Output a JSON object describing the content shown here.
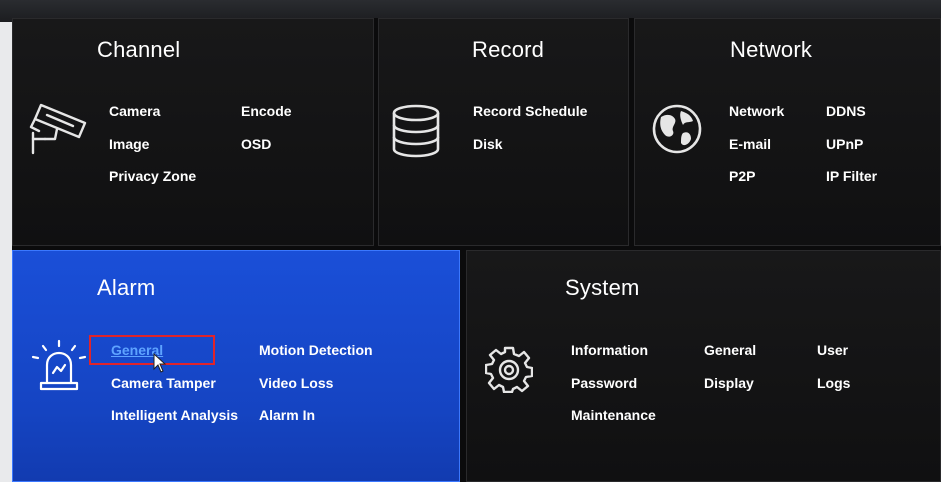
{
  "tiles": {
    "channel": {
      "title": "Channel",
      "icon": "camera-icon",
      "items": [
        "Camera",
        "Encode",
        "Image",
        "OSD",
        "Privacy Zone"
      ]
    },
    "record": {
      "title": "Record",
      "icon": "disk-stack-icon",
      "items": [
        "Record Schedule",
        "Disk"
      ]
    },
    "network": {
      "title": "Network",
      "icon": "globe-icon",
      "items": [
        "Network",
        "DDNS",
        "E-mail",
        "UPnP",
        "P2P",
        "IP Filter"
      ]
    },
    "alarm": {
      "title": "Alarm",
      "icon": "alarm-light-icon",
      "items": [
        "General",
        "Motion Detection",
        "Camera Tamper",
        "Video Loss",
        "Intelligent Analysis",
        "Alarm In"
      ],
      "active_item": "General"
    },
    "system": {
      "title": "System",
      "icon": "gear-icon",
      "items": [
        "Information",
        "General",
        "User",
        "Password",
        "Display",
        "Logs",
        "Maintenance"
      ]
    }
  },
  "colors": {
    "selected_tile": "#1a4fd8",
    "dark_tile": "#141415",
    "highlight_box": "#e0242a",
    "active_link": "#5ea3ff"
  }
}
